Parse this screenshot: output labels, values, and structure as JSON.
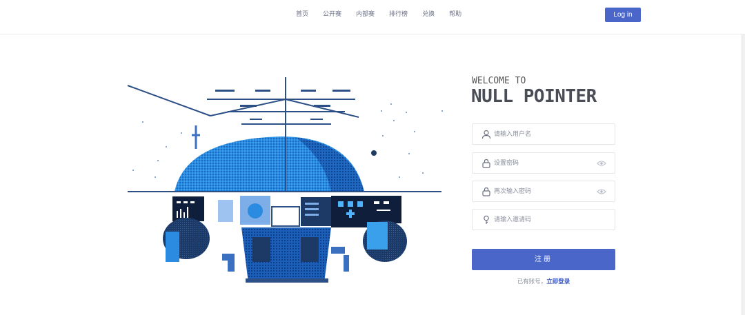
{
  "nav": {
    "items": [
      {
        "label": "首页"
      },
      {
        "label": "公开赛"
      },
      {
        "label": "内部赛"
      },
      {
        "label": "排行榜"
      },
      {
        "label": "兑换"
      },
      {
        "label": "帮助"
      }
    ],
    "login_label": "Log in"
  },
  "hero": {
    "welcome": "WELCOME TO",
    "brand": "NULL POINTER"
  },
  "form": {
    "username_placeholder": "请输入用户名",
    "password_placeholder": "设置密码",
    "confirm_placeholder": "再次输入密码",
    "invite_placeholder": "请输入邀请码",
    "submit_label": "注册",
    "footer_text": "已有账号，",
    "footer_link": "立即登录"
  },
  "icons": {
    "username": "user-icon",
    "password": "lock-icon",
    "confirm": "lock-icon",
    "invite": "key-icon",
    "toggle": "eye-icon"
  },
  "colors": {
    "accent": "#4a66c8",
    "link": "#3b57c4",
    "planet": "#1e7fd8"
  }
}
